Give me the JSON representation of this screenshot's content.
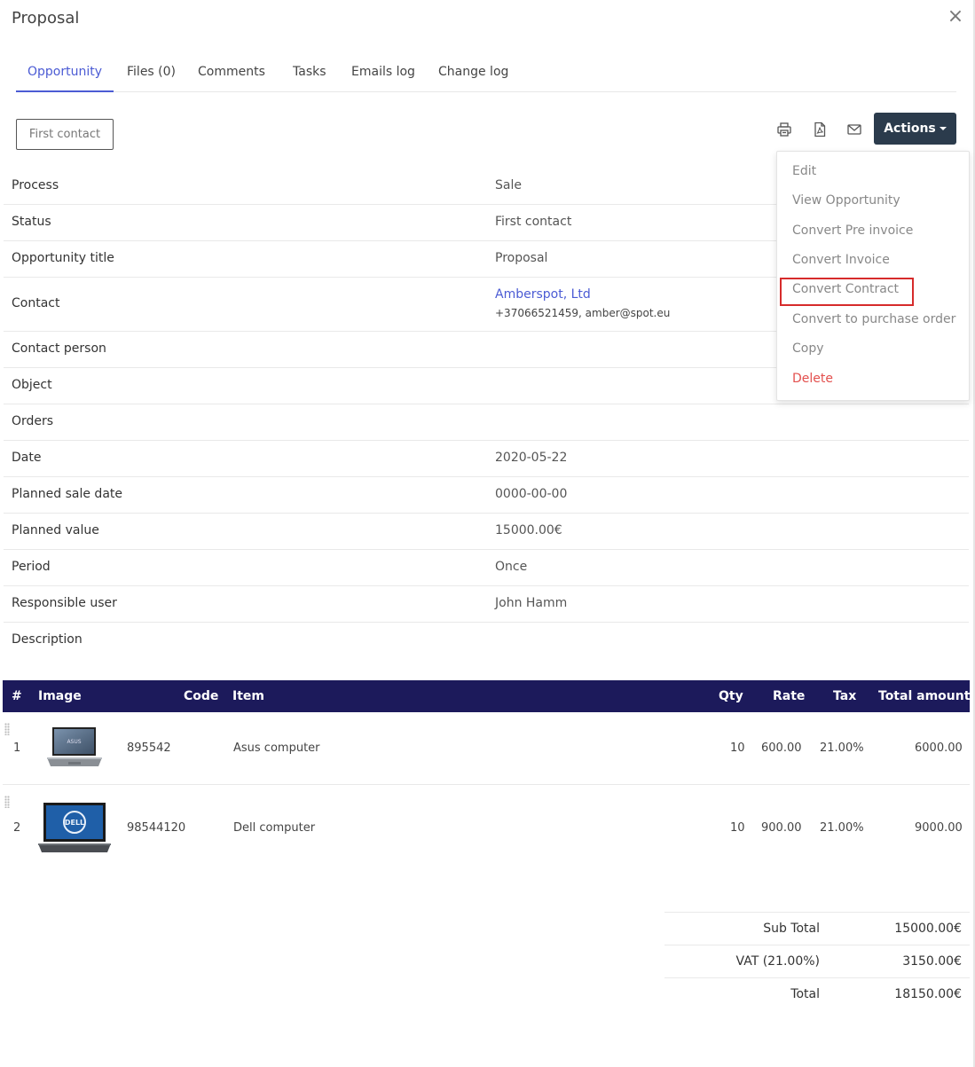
{
  "modal": {
    "title": "Proposal",
    "close_glyph": "×"
  },
  "tabs": [
    {
      "label": "Opportunity",
      "active": true
    },
    {
      "label": "Files (0)"
    },
    {
      "label": "Comments"
    },
    {
      "label": "Tasks"
    },
    {
      "label": "Emails log"
    },
    {
      "label": "Change log"
    }
  ],
  "toolbar": {
    "stage_label": "First contact",
    "icons": [
      "print-icon",
      "pdf-icon",
      "email-icon"
    ],
    "actions_label": "Actions"
  },
  "actions_menu": {
    "items": [
      {
        "label": "Edit"
      },
      {
        "label": "View Opportunity"
      },
      {
        "label": "Convert Pre invoice"
      },
      {
        "label": "Convert Invoice"
      },
      {
        "label": "Convert Contract",
        "highlighted": true
      },
      {
        "label": "Convert to purchase order"
      },
      {
        "label": "Copy"
      },
      {
        "label": "Delete",
        "danger": true
      }
    ],
    "danger_color": "#e3504e",
    "highlight_color": "#d62b2b"
  },
  "details": {
    "rows": [
      {
        "label": "Process",
        "value": "Sale"
      },
      {
        "label": "Status",
        "value": "First contact"
      },
      {
        "label": "Opportunity title",
        "value": "Proposal"
      },
      {
        "label": "Contact",
        "value": "Amberspot, Ltd",
        "meta": "+37066521459, amber@spot.eu"
      },
      {
        "label": "Contact person",
        "value": ""
      },
      {
        "label": "Object",
        "value": ""
      },
      {
        "label": "Orders",
        "value": ""
      },
      {
        "label": "Date",
        "value": "2020-05-22"
      },
      {
        "label": "Planned sale date",
        "value": "0000-00-00"
      },
      {
        "label": "Planned value",
        "value": "15000.00€"
      },
      {
        "label": "Period",
        "value": "Once"
      },
      {
        "label": "Responsible user",
        "value": "John Hamm"
      },
      {
        "label": "Description",
        "value": ""
      }
    ]
  },
  "items_table": {
    "header_color": "#1c1a5b",
    "columns": [
      "#",
      "Image",
      "Code",
      "Item",
      "Qty",
      "Rate",
      "Tax",
      "Total amount"
    ],
    "rows": [
      {
        "num": "1",
        "image": "asus-laptop-image",
        "code": "895542",
        "item": "Asus computer",
        "qty": "10",
        "rate": "600.00",
        "tax": "21.00%",
        "total": "6000.00"
      },
      {
        "num": "2",
        "image": "dell-laptop-image",
        "code": "98544120",
        "item": "Dell computer",
        "qty": "10",
        "rate": "900.00",
        "tax": "21.00%",
        "total": "9000.00"
      }
    ]
  },
  "totals": [
    {
      "label": "Sub Total",
      "value": "15000.00€"
    },
    {
      "label": "VAT (21.00%)",
      "value": "3150.00€"
    },
    {
      "label": "Total",
      "value": "18150.00€"
    }
  ],
  "colors": {
    "accent": "#4b5bd4",
    "actions_button": "#2b3b4c"
  }
}
